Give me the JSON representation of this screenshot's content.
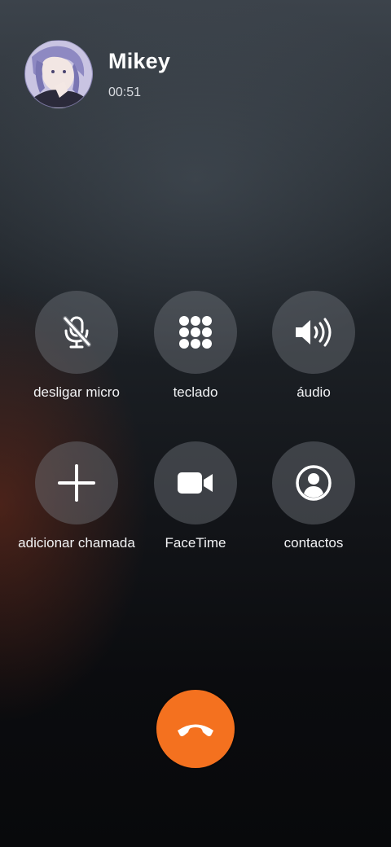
{
  "caller": {
    "name": "Mikey",
    "duration": "00:51"
  },
  "controls": {
    "mute": {
      "label": "desligar micro",
      "icon": "mic-off-icon"
    },
    "keypad": {
      "label": "teclado",
      "icon": "keypad-icon"
    },
    "audio": {
      "label": "áudio",
      "icon": "speaker-icon"
    },
    "add_call": {
      "label": "adicionar chamada",
      "icon": "plus-icon"
    },
    "facetime": {
      "label": "FaceTime",
      "icon": "video-camera-icon"
    },
    "contacts": {
      "label": "contactos",
      "icon": "person-circle-icon"
    }
  },
  "end_call": {
    "icon": "phone-hangup-icon",
    "color": "#f4711f"
  },
  "colors": {
    "button_bg": "#6f7379",
    "end_call": "#f4711f",
    "text": "#ffffff"
  }
}
